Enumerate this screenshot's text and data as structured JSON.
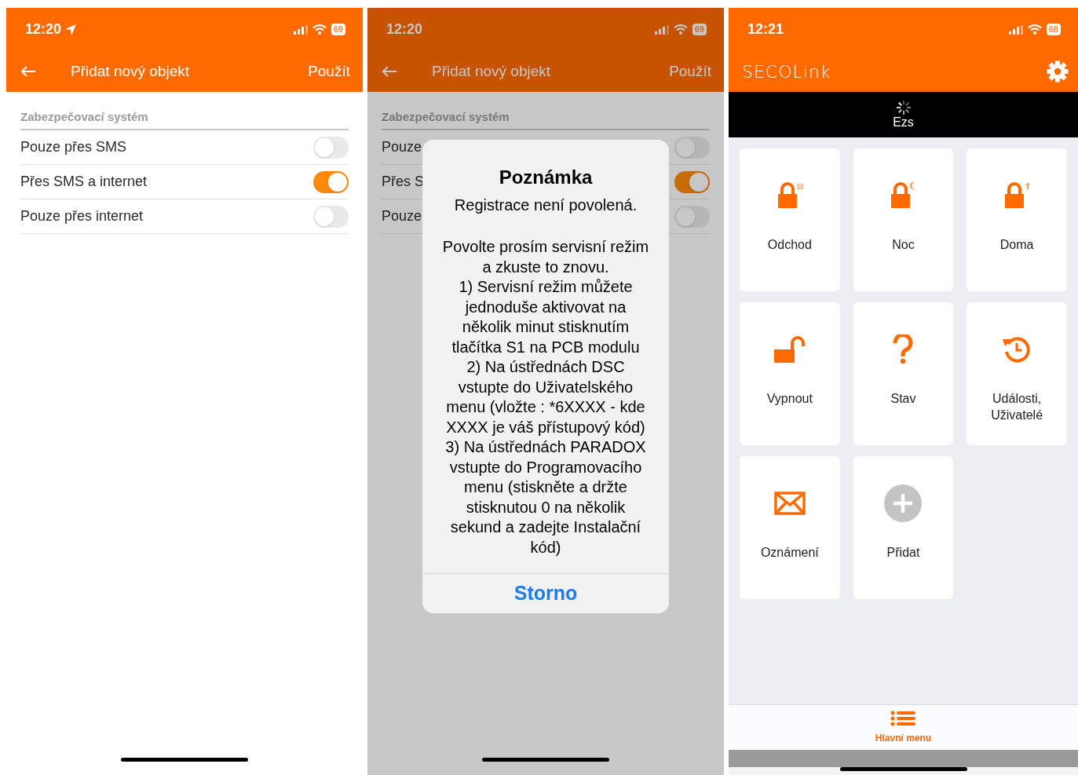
{
  "screens": [
    {
      "kind": "form",
      "status_bar": {
        "time": "12:20",
        "location": true,
        "battery": "69"
      },
      "header": {
        "title": "Přidat nový objekt",
        "action": "Použít"
      },
      "section": "Zabezpečovací systém",
      "options": [
        {
          "label": "Pouze přes SMS",
          "on": false
        },
        {
          "label": "Přes SMS a internet",
          "on": true
        },
        {
          "label": "Pouze přes internet",
          "on": false
        }
      ]
    },
    {
      "kind": "form",
      "status_bar": {
        "time": "12:20",
        "location": false,
        "battery": "69"
      },
      "header": {
        "title": "Přidat nový objekt",
        "action": "Použít"
      },
      "section": "Zabezpečovací systém",
      "options": [
        {
          "label": "Pouze",
          "on": false
        },
        {
          "label": "Přes S",
          "on": true
        },
        {
          "label": "Pouze",
          "on": false
        }
      ],
      "dialog": {
        "title": "Poznámka",
        "subtitle": "Registrace není povolená.",
        "message": "Povolte prosím servisní režim a zkuste to znovu.\n1) Servisní režim můžete jednoduše aktivovat na několik minut stisknutím tlačítka S1 na PCB modulu\n2) Na ústřednách DSC vstupte do Uživatelského menu (vložte : *6XXXX - kde XXXX je váš přístupový kód)\n3) Na ústřednách PARADOX vstupte do Programovacího menu (stiskněte a držte stisknutou 0 na několik sekund a zadejte Instalační kód)",
        "button": "Storno"
      }
    },
    {
      "kind": "dashboard",
      "status_bar": {
        "time": "12:21",
        "location": false,
        "battery": "68"
      },
      "logo": "SECOLink",
      "system": "Ezs",
      "tiles": [
        {
          "label": "Odchod",
          "kind": "lock_hash"
        },
        {
          "label": "Noc",
          "kind": "lock_moon"
        },
        {
          "label": "Doma",
          "kind": "lock_arrow"
        },
        {
          "label": "Vypnout",
          "kind": "unlock"
        },
        {
          "label": "Stav",
          "kind": "question"
        },
        {
          "label": "Události, Uživatelé",
          "kind": "history"
        },
        {
          "label": "Oznámení",
          "kind": "mail"
        },
        {
          "label": "Přidat",
          "kind": "add"
        }
      ],
      "nav": {
        "label": "Hlavní menu"
      }
    }
  ]
}
